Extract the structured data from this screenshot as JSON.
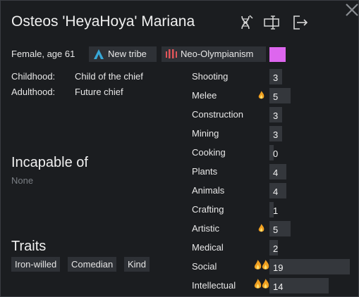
{
  "pawn": {
    "name": "Osteos 'HeyaHoya' Mariana",
    "gender_age": "Female, age 61"
  },
  "faction": {
    "label": "New tribe",
    "icon": "tribe-icon",
    "color": "#37a8d8"
  },
  "ideology": {
    "label": "Neo-Olympianism",
    "icon": "ideoligion-icon",
    "color": "#e0555a"
  },
  "favorite_color": "#dd66ee",
  "backstory": {
    "childhood_label": "Childhood:",
    "childhood_value": "Child of the chief",
    "adulthood_label": "Adulthood:",
    "adulthood_value": "Future chief"
  },
  "incapable": {
    "title": "Incapable of",
    "value": "None"
  },
  "traits": {
    "title": "Traits",
    "items": [
      "Iron-willed",
      "Comedian",
      "Kind"
    ]
  },
  "skills": [
    {
      "name": "Shooting",
      "level": 3,
      "passion": "none"
    },
    {
      "name": "Melee",
      "level": 5,
      "passion": "minor"
    },
    {
      "name": "Construction",
      "level": 3,
      "passion": "none"
    },
    {
      "name": "Mining",
      "level": 3,
      "passion": "none"
    },
    {
      "name": "Cooking",
      "level": 0,
      "passion": "none"
    },
    {
      "name": "Plants",
      "level": 4,
      "passion": "none"
    },
    {
      "name": "Animals",
      "level": 4,
      "passion": "none"
    },
    {
      "name": "Crafting",
      "level": 1,
      "passion": "none"
    },
    {
      "name": "Artistic",
      "level": 5,
      "passion": "minor"
    },
    {
      "name": "Medical",
      "level": 2,
      "passion": "none"
    },
    {
      "name": "Social",
      "level": 19,
      "passion": "major"
    },
    {
      "name": "Intellectual",
      "level": 14,
      "passion": "major"
    }
  ],
  "header_icons": [
    "dna-icon",
    "rename-icon",
    "banish-icon"
  ],
  "close_icon": "close-icon"
}
